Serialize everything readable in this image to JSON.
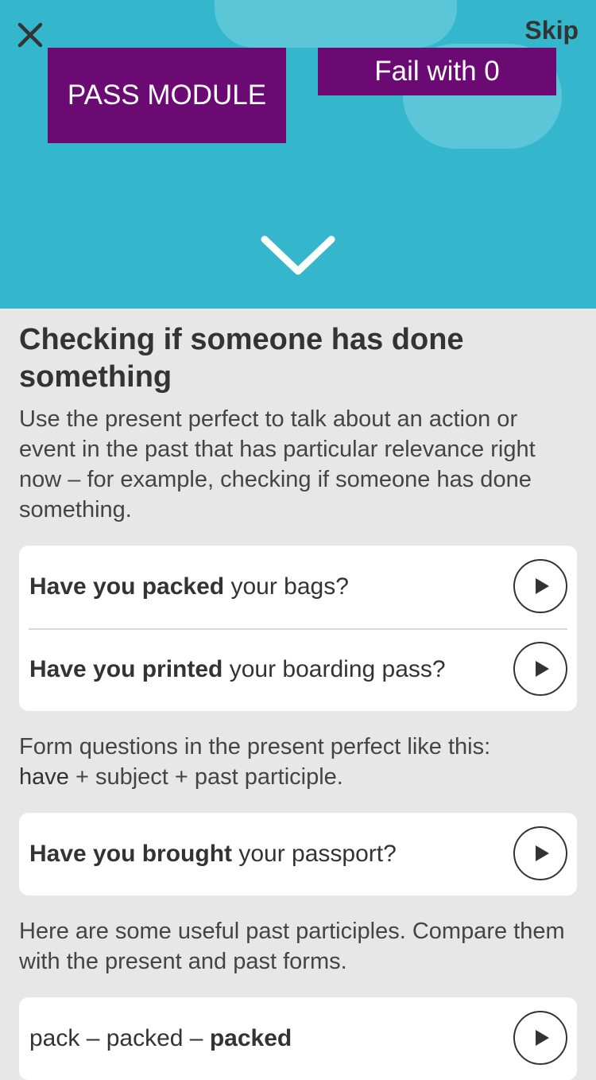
{
  "header": {
    "skip_label": "Skip",
    "pass_label": "PASS MODULE",
    "fail_label": "Fail with 0",
    "close_icon": "close-icon",
    "expand_icon": "chevron-down-icon"
  },
  "colors": {
    "hero_bg": "#34b6cc",
    "cloud": "#5ac6d8",
    "button_purple": "#6c0a74",
    "page_bg": "#e7e7e7",
    "card_bg": "#ffffff"
  },
  "lesson": {
    "title": "Checking if someone has done something",
    "intro": "Use the present perfect to talk about an action or event in the past that has particular relevance right now – for example, checking if someone has done something.",
    "examples1": [
      {
        "bold": "Have you packed",
        "rest": " your bags?"
      },
      {
        "bold": "Have you printed",
        "rest": " your boarding pass?"
      }
    ],
    "form_text": "Form questions in the present perfect like this:",
    "formula_have": "have",
    "formula_rest": " + subject + past participle.",
    "examples2": [
      {
        "bold": "Have you brought",
        "rest": " your passport?"
      }
    ],
    "participles_text": "Here are some useful past participles. Compare them with the present and past forms.",
    "examples3": [
      {
        "plain": "pack – packed – ",
        "bold": "packed"
      }
    ]
  }
}
